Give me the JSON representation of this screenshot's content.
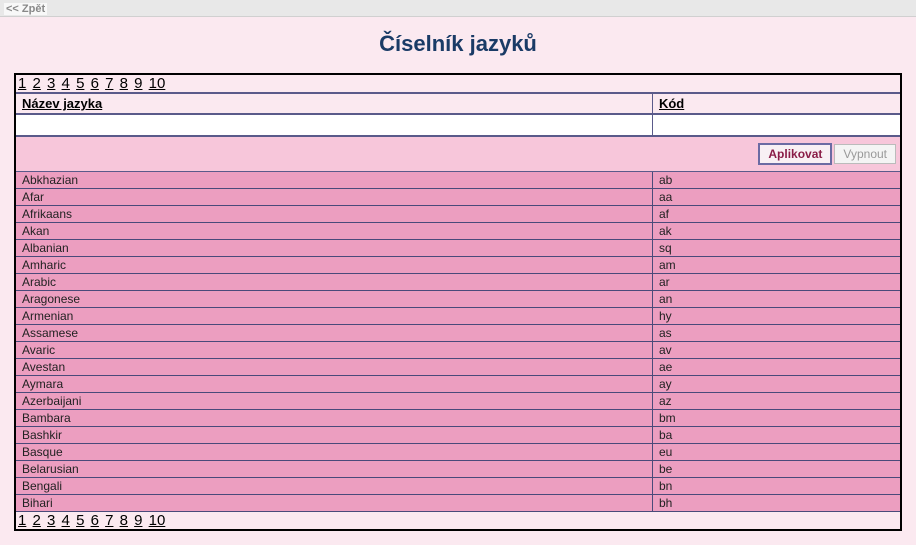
{
  "nav": {
    "back_label": "<< Zpět"
  },
  "page": {
    "title": "Číselník jazyků"
  },
  "pager": {
    "pages": [
      "1",
      "2",
      "3",
      "4",
      "5",
      "6",
      "7",
      "8",
      "9",
      "10"
    ]
  },
  "table": {
    "headers": {
      "name": "Název jazyka",
      "code": "Kód"
    },
    "filters": {
      "name_value": "",
      "code_value": ""
    },
    "actions": {
      "apply": "Aplikovat",
      "off": "Vypnout"
    },
    "rows": [
      {
        "name": "Abkhazian",
        "code": "ab"
      },
      {
        "name": "Afar",
        "code": "aa"
      },
      {
        "name": "Afrikaans",
        "code": "af"
      },
      {
        "name": "Akan",
        "code": "ak"
      },
      {
        "name": "Albanian",
        "code": "sq"
      },
      {
        "name": "Amharic",
        "code": "am"
      },
      {
        "name": "Arabic",
        "code": "ar"
      },
      {
        "name": "Aragonese",
        "code": "an"
      },
      {
        "name": "Armenian",
        "code": "hy"
      },
      {
        "name": "Assamese",
        "code": "as"
      },
      {
        "name": "Avaric",
        "code": "av"
      },
      {
        "name": "Avestan",
        "code": "ae"
      },
      {
        "name": "Aymara",
        "code": "ay"
      },
      {
        "name": "Azerbaijani",
        "code": "az"
      },
      {
        "name": "Bambara",
        "code": "bm"
      },
      {
        "name": "Bashkir",
        "code": "ba"
      },
      {
        "name": "Basque",
        "code": "eu"
      },
      {
        "name": "Belarusian",
        "code": "be"
      },
      {
        "name": "Bengali",
        "code": "bn"
      },
      {
        "name": "Bihari",
        "code": "bh"
      }
    ]
  }
}
